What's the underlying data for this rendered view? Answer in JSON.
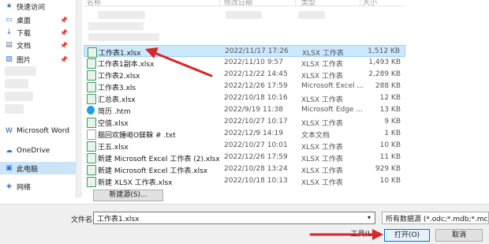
{
  "sidebar": {
    "items": [
      {
        "label": "快速访问",
        "icon": "star-icon",
        "pinned": false,
        "selected": false
      },
      {
        "label": "桌面",
        "icon": "desktop-icon",
        "pinned": true,
        "selected": false
      },
      {
        "label": "下载",
        "icon": "download-icon",
        "pinned": true,
        "selected": false
      },
      {
        "label": "文档",
        "icon": "document-icon",
        "pinned": true,
        "selected": false
      },
      {
        "label": "图片",
        "icon": "picture-icon",
        "pinned": true,
        "selected": false
      },
      {
        "label": "Microsoft Word",
        "icon": "word-icon",
        "pinned": false,
        "selected": false
      },
      {
        "label": "OneDrive",
        "icon": "cloud-icon",
        "pinned": false,
        "selected": false
      },
      {
        "label": "此电脑",
        "icon": "computer-icon",
        "pinned": false,
        "selected": true
      },
      {
        "label": "网络",
        "icon": "network-icon",
        "pinned": false,
        "selected": false
      }
    ]
  },
  "columns": {
    "name": "名称",
    "date": "修改日期",
    "type": "类型",
    "size": "大小"
  },
  "files": [
    {
      "name": "工作表1.xlsx",
      "date": "2022/11/17 17:26",
      "type": "XLSX 工作表",
      "size": "1,512 KB",
      "icon": "excel-file-icon",
      "selected": true
    },
    {
      "name": "工作表1副本.xlsx",
      "date": "2022/11/10 9:57",
      "type": "XLSX 工作表",
      "size": "1,493 KB",
      "icon": "excel-file-icon",
      "selected": false
    },
    {
      "name": "工作表2.xlsx",
      "date": "2022/12/22 14:45",
      "type": "XLSX 工作表",
      "size": "2,289 KB",
      "icon": "excel-file-icon",
      "selected": false
    },
    {
      "name": "工作表3.xls",
      "date": "2022/12/26 17:59",
      "type": "Microsoft Excel ...",
      "size": "288 KB",
      "icon": "excel-file-icon",
      "selected": false
    },
    {
      "name": "汇总表.xlsx",
      "date": "2022/10/18 10:16",
      "type": "XLSX 工作表",
      "size": "12 KB",
      "icon": "excel-file-icon",
      "selected": false
    },
    {
      "name": "简历 .htm",
      "date": "2022/9/19 11:38",
      "type": "Microsoft Edge ...",
      "size": "13 KB",
      "icon": "edge-file-icon",
      "selected": false
    },
    {
      "name": "空值.xlsx",
      "date": "2022/10/27 10:17",
      "type": "XLSX 工作表",
      "size": "9 KB",
      "icon": "excel-file-icon",
      "selected": false
    },
    {
      "name": "腦回欢鍾峘O鎂榦 # .txt",
      "date": "2022/12/9 14:19",
      "type": "文本文档",
      "size": "1 KB",
      "icon": "text-file-icon",
      "selected": false
    },
    {
      "name": "王五.xlsx",
      "date": "2022/10/27 10:01",
      "type": "XLSX 工作表",
      "size": "10 KB",
      "icon": "excel-file-icon",
      "selected": false
    },
    {
      "name": "新建 Microsoft Excel 工作表 (2).xlsx",
      "date": "2022/12/26 17:59",
      "type": "XLSX 工作表",
      "size": "11 KB",
      "icon": "excel-file-icon",
      "selected": false
    },
    {
      "name": "新建 Microsoft Excel 工作表.xlsx",
      "date": "2022/10/28 13:24",
      "type": "XLSX 工作表",
      "size": "929 KB",
      "icon": "excel-file-icon",
      "selected": false
    },
    {
      "name": "新建 XLSX 工作表.xlsx",
      "date": "2022/10/18 10:13",
      "type": "XLSX 工作表",
      "size": "10 KB",
      "icon": "excel-file-icon",
      "selected": false
    }
  ],
  "new_source_button": "新建源(S)...",
  "filename": {
    "label": "文件名(N):",
    "value": "工作表1.xlsx"
  },
  "filter": {
    "value": "所有数据源 (*.odc;*.mdb;*.mc"
  },
  "tools_label": "工具(L)",
  "open_label": "打开(O)",
  "cancel_label": "取消",
  "colors": {
    "accent": "#0078d7",
    "selection": "#cce8ff",
    "arrow": "#d9262a"
  }
}
